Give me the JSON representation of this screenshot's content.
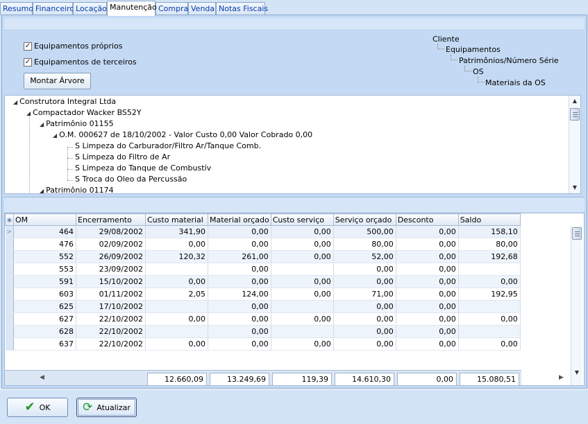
{
  "tabs": [
    {
      "label": "Resumo",
      "active": false
    },
    {
      "label": "Financeiro",
      "active": false
    },
    {
      "label": "Locação",
      "active": false
    },
    {
      "label": "Manutenção",
      "active": true
    },
    {
      "label": "Compra",
      "active": false
    },
    {
      "label": "Venda",
      "active": false
    },
    {
      "label": "Notas Fiscais",
      "active": false
    }
  ],
  "options": {
    "own_equipment": {
      "label": "Equipamentos próprios",
      "checked": true
    },
    "third_party_equipment": {
      "label": "Equipamentos de terceiros",
      "checked": true
    },
    "build_tree_button": "Montar Árvore"
  },
  "legend": {
    "level0": "Cliente",
    "level1": "Equipamentos",
    "level2": "Patrimônios/Número Série",
    "level3": "OS",
    "level4": "Materiais da OS"
  },
  "tree": {
    "client": "Construtora Integral  Ltda",
    "equipment": "Compactador Wacker BS52Y",
    "asset1": "Patrimônio 01155",
    "order": "O.M. 000627 de 18/10/2002 - Valor Custo 0,00 Valor Cobrado 0,00",
    "materials": [
      "S  Limpeza do Carburador/Filtro Ar/Tanque Comb.",
      "S  Limpeza do Filtro de Ar",
      "S  Limpeza do Tanque de Combustív",
      "S  Troca do Oleo da Percussão"
    ],
    "asset2": "Patrimônio 01174"
  },
  "grid": {
    "columns": [
      "OM",
      "Encerramento",
      "Custo material",
      "Material orçado",
      "Custo serviço",
      "Serviço orçado",
      "Desconto",
      "Saldo"
    ],
    "rows": [
      [
        "464",
        "29/08/2002",
        "341,90",
        "0,00",
        "0,00",
        "500,00",
        "0,00",
        "158,10"
      ],
      [
        "476",
        "02/09/2002",
        "0,00",
        "0,00",
        "0,00",
        "80,00",
        "0,00",
        "80,00"
      ],
      [
        "552",
        "26/09/2002",
        "120,32",
        "261,00",
        "0,00",
        "52,00",
        "0,00",
        "192,68"
      ],
      [
        "553",
        "23/09/2002",
        "",
        "0,00",
        "",
        "0,00",
        "0,00",
        ""
      ],
      [
        "591",
        "15/10/2002",
        "0,00",
        "0,00",
        "0,00",
        "0,00",
        "0,00",
        "0,00"
      ],
      [
        "603",
        "01/11/2002",
        "2,05",
        "124,00",
        "0,00",
        "71,00",
        "0,00",
        "192,95"
      ],
      [
        "625",
        "17/10/2002",
        "",
        "0,00",
        "",
        "0,00",
        "0,00",
        ""
      ],
      [
        "627",
        "22/10/2002",
        "0,00",
        "0,00",
        "0,00",
        "0,00",
        "0,00",
        "0,00"
      ],
      [
        "628",
        "22/10/2002",
        "",
        "0,00",
        "",
        "0,00",
        "0,00",
        ""
      ],
      [
        "637",
        "22/10/2002",
        "0,00",
        "0,00",
        "0,00",
        "0,00",
        "0,00",
        "0,00"
      ]
    ],
    "totals": [
      "12.660,09",
      "13.249,69",
      "119,39",
      "14.610,30",
      "0,00",
      "15.080,51"
    ]
  },
  "buttons": {
    "ok": "OK",
    "refresh": "Atualizar"
  },
  "icons": {
    "ok": "checkmark-icon",
    "refresh": "refresh-icon"
  }
}
